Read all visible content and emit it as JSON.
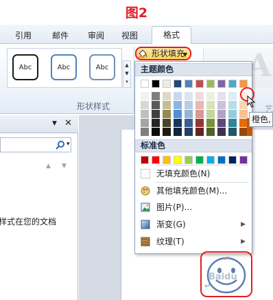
{
  "figure_title": "图2",
  "tabs": [
    {
      "label": "引用"
    },
    {
      "label": "邮件"
    },
    {
      "label": "审阅"
    },
    {
      "label": "视图"
    },
    {
      "label": "格式"
    }
  ],
  "gallery": {
    "boxes": [
      "Abc",
      "Abc",
      "Abc"
    ],
    "group_label": "形状样式"
  },
  "fill_button": {
    "label": "形状填充"
  },
  "right_group": {
    "label_partial": "艺",
    "big_letter": "A"
  },
  "dropdown": {
    "theme_header": "主题颜色",
    "standard_header": "标准色",
    "theme_top_row": [
      "#ffffff",
      "#000000",
      "#eeece1",
      "#1f497d",
      "#4f81bd",
      "#c0504d",
      "#9bbb59",
      "#8064a2",
      "#4bacc6",
      "#f79646"
    ],
    "theme_shades": [
      [
        "#f2f2f2",
        "#7f7f7f",
        "#ddd9c3",
        "#c6d9f0",
        "#dbe5f1",
        "#f2dcdb",
        "#ebf1dd",
        "#e5e0ec",
        "#dbeef3",
        "#fdeada"
      ],
      [
        "#d8d8d8",
        "#595959",
        "#c4bd97",
        "#8db3e2",
        "#b8cce4",
        "#e5b9b7",
        "#d7e3bc",
        "#ccc1d9",
        "#b7dde8",
        "#fbd5b5"
      ],
      [
        "#bfbfbf",
        "#3f3f3f",
        "#938953",
        "#548dd4",
        "#95b3d7",
        "#d99694",
        "#c3d69b",
        "#b2a2c7",
        "#92cddc",
        "#fac08f"
      ],
      [
        "#a5a5a5",
        "#262626",
        "#494429",
        "#17365d",
        "#366092",
        "#953734",
        "#76923c",
        "#5f497a",
        "#31859b",
        "#e36c09"
      ],
      [
        "#7f7f7f",
        "#0c0c0c",
        "#1d1b10",
        "#0f243e",
        "#244061",
        "#632423",
        "#4f6128",
        "#3f3151",
        "#205867",
        "#974806"
      ]
    ],
    "standard_colors": [
      "#c00000",
      "#ff0000",
      "#ffc000",
      "#ffff00",
      "#92d050",
      "#00b050",
      "#00b0f0",
      "#0070c0",
      "#002060",
      "#7030a0"
    ],
    "menu": [
      {
        "label": "无填充颜色(N)",
        "icon": "none-swatch-icon",
        "submenu": false
      },
      {
        "label": "其他填充颜色(M)...",
        "icon": "palette-icon",
        "submenu": false
      },
      {
        "label": "图片(P)...",
        "icon": "picture-icon",
        "submenu": false
      },
      {
        "label": "渐变(G)",
        "icon": "gradient-icon",
        "submenu": true
      },
      {
        "label": "纹理(T)",
        "icon": "texture-icon",
        "submenu": true
      }
    ]
  },
  "tooltip": {
    "text": "橙色, 强"
  },
  "pane": {
    "text": "样式在您的文档"
  },
  "watermark": "Baidu"
}
